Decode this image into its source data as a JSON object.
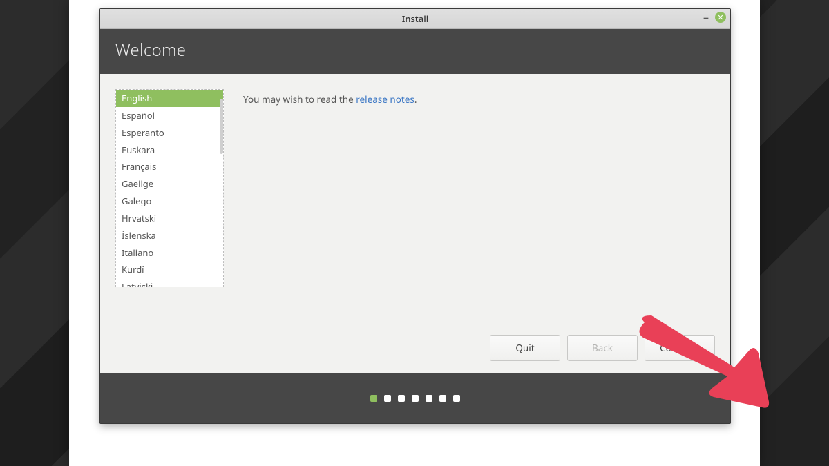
{
  "window": {
    "title": "Install",
    "minimize_glyph": "–",
    "close_glyph": "✕"
  },
  "header": {
    "title": "Welcome"
  },
  "languages": {
    "selected_index": 0,
    "items": [
      "English",
      "Español",
      "Esperanto",
      "Euskara",
      "Français",
      "Gaeilge",
      "Galego",
      "Hrvatski",
      "Íslenska",
      "Italiano",
      "Kurdî",
      "Latviski"
    ]
  },
  "info": {
    "prefix": "You may wish to read the ",
    "link_text": "release notes",
    "suffix": "."
  },
  "buttons": {
    "quit": "Quit",
    "back": "Back",
    "continue": "Continue",
    "back_disabled": true
  },
  "progress": {
    "total": 7,
    "current": 0
  },
  "colors": {
    "accent": "#8fbf5f",
    "arrow": "#e94057"
  }
}
